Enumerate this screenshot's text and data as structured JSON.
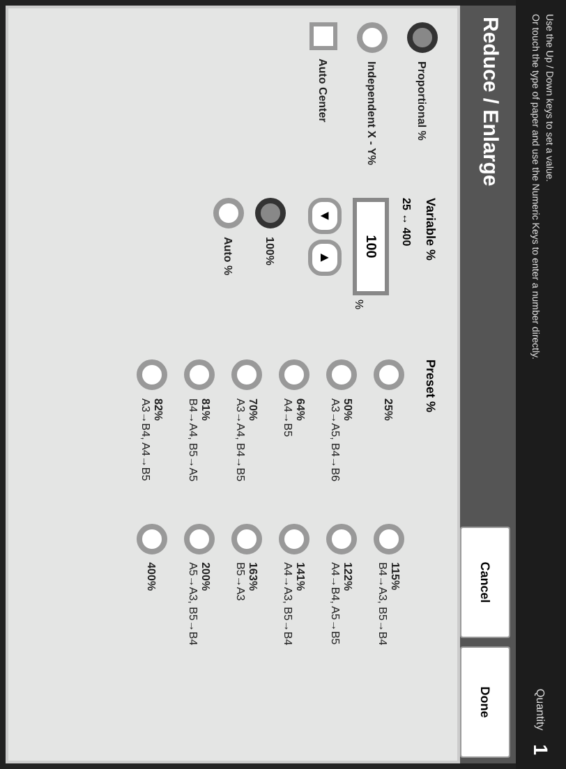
{
  "status_bar": {
    "messages": [
      "Use the Up / Down keys to set a value.",
      "Or touch the type of paper and use the Numeric Keys to enter a number directly."
    ],
    "quantity_label": "Quantity",
    "quantity": "1"
  },
  "title": "Reduce / Enlarge",
  "buttons": [
    "Cancel",
    "Done"
  ],
  "modes": [
    {
      "kind": "radio",
      "label": "Proportional %",
      "selected": true
    },
    {
      "kind": "radio",
      "label": "Independent X - Y%",
      "selected": false
    },
    {
      "kind": "checkbox",
      "label": "Auto Center",
      "checked": false
    }
  ],
  "variable": {
    "heading": "Variable %",
    "range": "25 ↔ 400",
    "value": "100",
    "unit": "%",
    "arrows": [
      "▼",
      "▲"
    ]
  },
  "scale_options": [
    {
      "label": "100%",
      "selected": true
    },
    {
      "label": "Auto %",
      "selected": false
    }
  ],
  "preset": {
    "heading": "Preset %",
    "columns": [
      [
        {
          "percent": "25%",
          "selected": false
        },
        {
          "percent": "50%",
          "sizes": "A3→A5, B4→B6",
          "selected": false
        },
        {
          "percent": "64%",
          "sizes": "A4→B5",
          "selected": false
        },
        {
          "percent": "70%",
          "sizes": "A3→A4, B4→B5",
          "selected": false
        },
        {
          "percent": "81%",
          "sizes": "B4→A4, B5→A5",
          "selected": false
        },
        {
          "percent": "82%",
          "sizes": "A3→B4, A4→B5",
          "selected": false
        }
      ],
      [
        {
          "percent": "115%",
          "sizes": "B4→A3, B5→B4",
          "selected": false
        },
        {
          "percent": "122%",
          "sizes": "A4→B4, A5→B5",
          "selected": false
        },
        {
          "percent": "141%",
          "sizes": "A4→A3, B5→B4",
          "selected": false
        },
        {
          "percent": "163%",
          "sizes": "B5→A3",
          "selected": false
        },
        {
          "percent": "200%",
          "sizes": "A5→A3, B5→B4",
          "selected": false
        },
        {
          "percent": "400%",
          "selected": false
        }
      ]
    ]
  }
}
